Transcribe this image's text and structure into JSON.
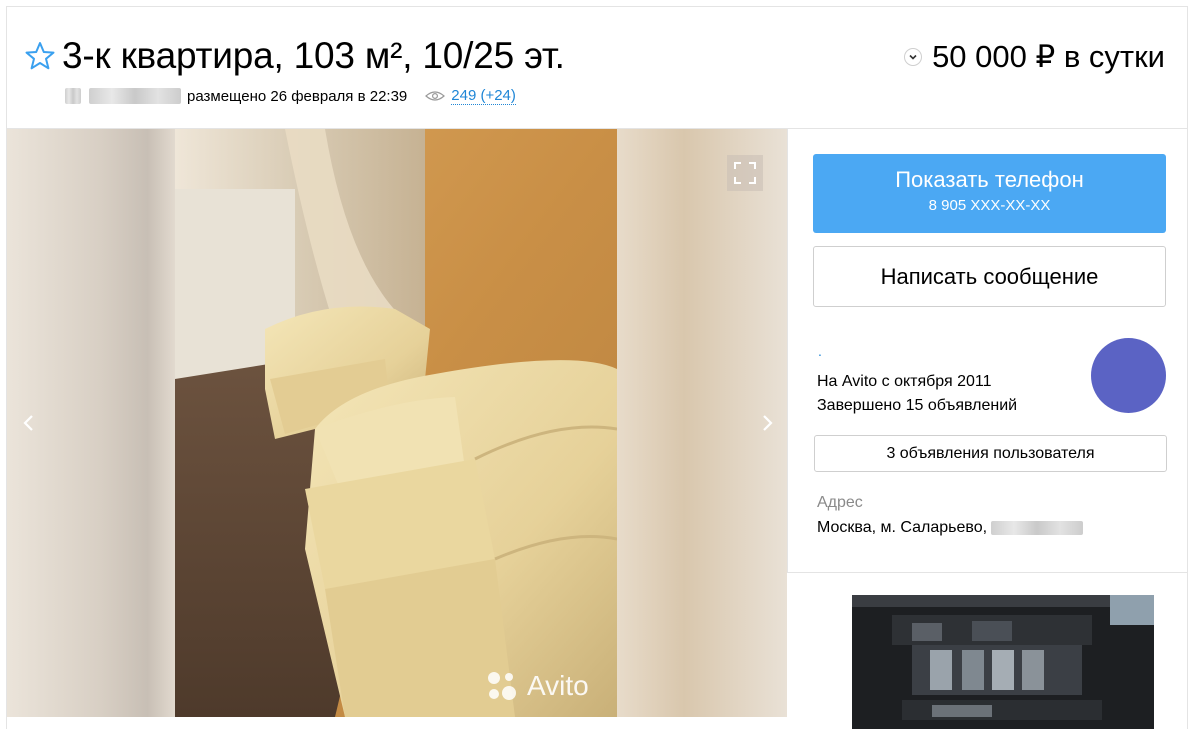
{
  "listing": {
    "title": "3-к квартира, 103 м², 10/25 эт.",
    "price": "50 000 ₽ в сутки",
    "posted": "размещено 26 февраля в 22:39",
    "views": "249 (+24)"
  },
  "gallery": {
    "watermark": "Avito"
  },
  "contact": {
    "phone_label": "Показать телефон",
    "phone_number": "8 905 XXX-XX-XX",
    "message_label": "Написать сообщение",
    "seller_name": ".",
    "seller_since": "На Avito с октября 2011",
    "seller_completed": "Завершено 15 объявлений",
    "seller_ads_label": "3 объявления пользователя",
    "address_label": "Адрес",
    "address_value": "Москва, м. Саларьево,"
  },
  "colors": {
    "accent": "#4ba8f3",
    "link": "#1f86d6",
    "avatar": "#5b63c4"
  }
}
